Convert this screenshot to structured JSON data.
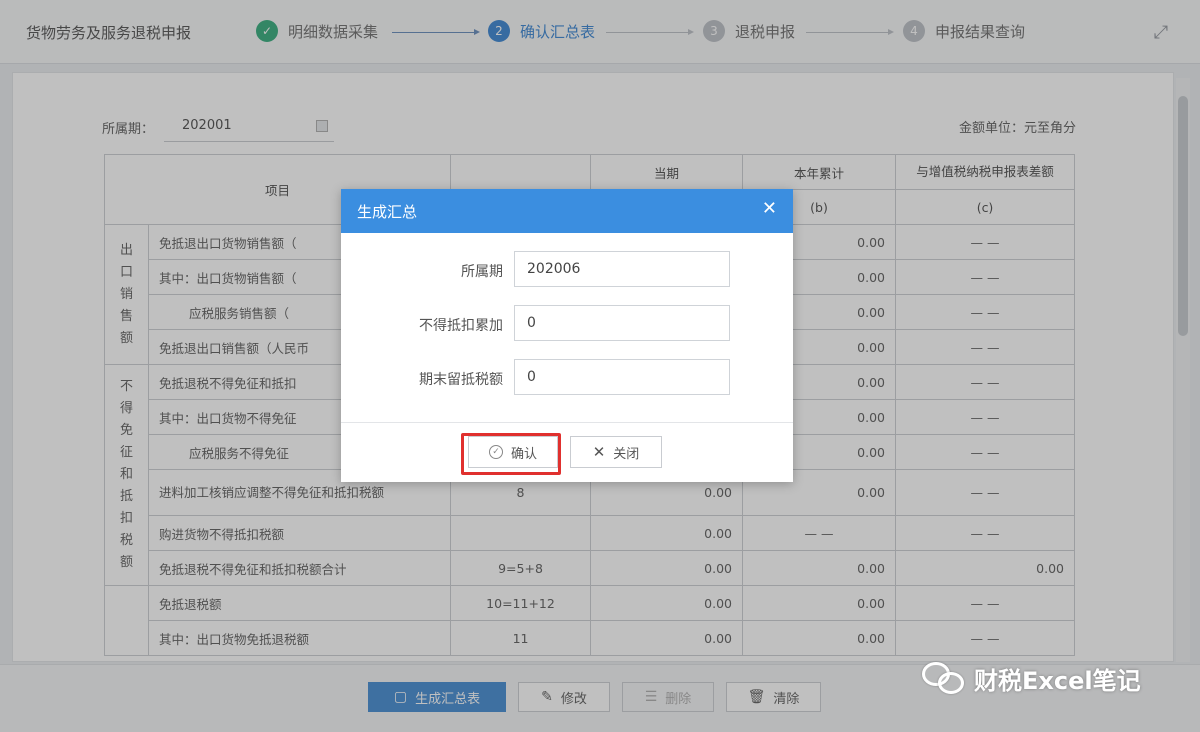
{
  "app": {
    "title": "货物劳务及服务退税申报"
  },
  "steps": [
    {
      "num": "✓",
      "label": "明细数据采集",
      "state": "done"
    },
    {
      "num": "2",
      "label": "确认汇总表",
      "state": "active"
    },
    {
      "num": "3",
      "label": "退税申报",
      "state": "todo"
    },
    {
      "num": "4",
      "label": "申报结果查询",
      "state": "todo"
    }
  ],
  "form": {
    "period_label": "所属期：",
    "period_value": "202001",
    "unit_label": "金额单位：元至角分"
  },
  "table": {
    "headers": {
      "item": "项目",
      "current": "当期",
      "ytd": "本年累计",
      "diff": "与增值税纳税申报表差额",
      "col_b": "(b)",
      "col_c": "(c)"
    },
    "group_export": "出口销售额",
    "group_nondeduct": "不得免征和抵扣税额",
    "rows": [
      {
        "label": "免抵退出口货物销售额（",
        "line": "",
        "current": "",
        "ytd": "0.00",
        "diff": "— —"
      },
      {
        "label": "其中：出口货物销售额（",
        "line": "",
        "current": "",
        "ytd": "0.00",
        "diff": "— —"
      },
      {
        "label": "应税服务销售额（",
        "line": "",
        "current": "",
        "ytd": "0.00",
        "diff": "— —"
      },
      {
        "label": "免抵退出口销售额（人民币",
        "line": "",
        "current": "",
        "ytd": "0.00",
        "diff": "— —"
      },
      {
        "label": "免抵退税不得免征和抵扣",
        "line": "",
        "current": "",
        "ytd": "0.00",
        "diff": "— —"
      },
      {
        "label": "其中：出口货物不得免征",
        "line": "",
        "current": "",
        "ytd": "0.00",
        "diff": "— —"
      },
      {
        "label": "应税服务不得免征",
        "line": "",
        "current": "",
        "ytd": "0.00",
        "diff": "— —"
      },
      {
        "label": "进料加工核销应调整不得免征和抵扣税额",
        "line": "8",
        "current": "0.00",
        "ytd": "0.00",
        "diff": "— —"
      },
      {
        "label": "购进货物不得抵扣税额",
        "line": "",
        "current": "0.00",
        "ytd": "— —",
        "diff": "— —"
      },
      {
        "label": "免抵退税不得免征和抵扣税额合计",
        "line": "9=5+8",
        "current": "0.00",
        "ytd": "0.00",
        "diff": "0.00"
      },
      {
        "label": "免抵退税额",
        "line": "10=11+12",
        "current": "0.00",
        "ytd": "0.00",
        "diff": "— —"
      },
      {
        "label": "其中：出口货物免抵退税额",
        "line": "11",
        "current": "0.00",
        "ytd": "0.00",
        "diff": "— —"
      }
    ]
  },
  "toolbar": {
    "generate": "生成汇总表",
    "modify": "修改",
    "delete": "删除",
    "clear": "清除"
  },
  "watermark": "财税Excel笔记",
  "modal": {
    "title": "生成汇总",
    "fields": [
      {
        "label": "所属期",
        "value": "202006"
      },
      {
        "label": "不得抵扣累加",
        "value": "0"
      },
      {
        "label": "期末留抵税额",
        "value": "0"
      }
    ],
    "confirm": "确认",
    "close": "关闭"
  }
}
